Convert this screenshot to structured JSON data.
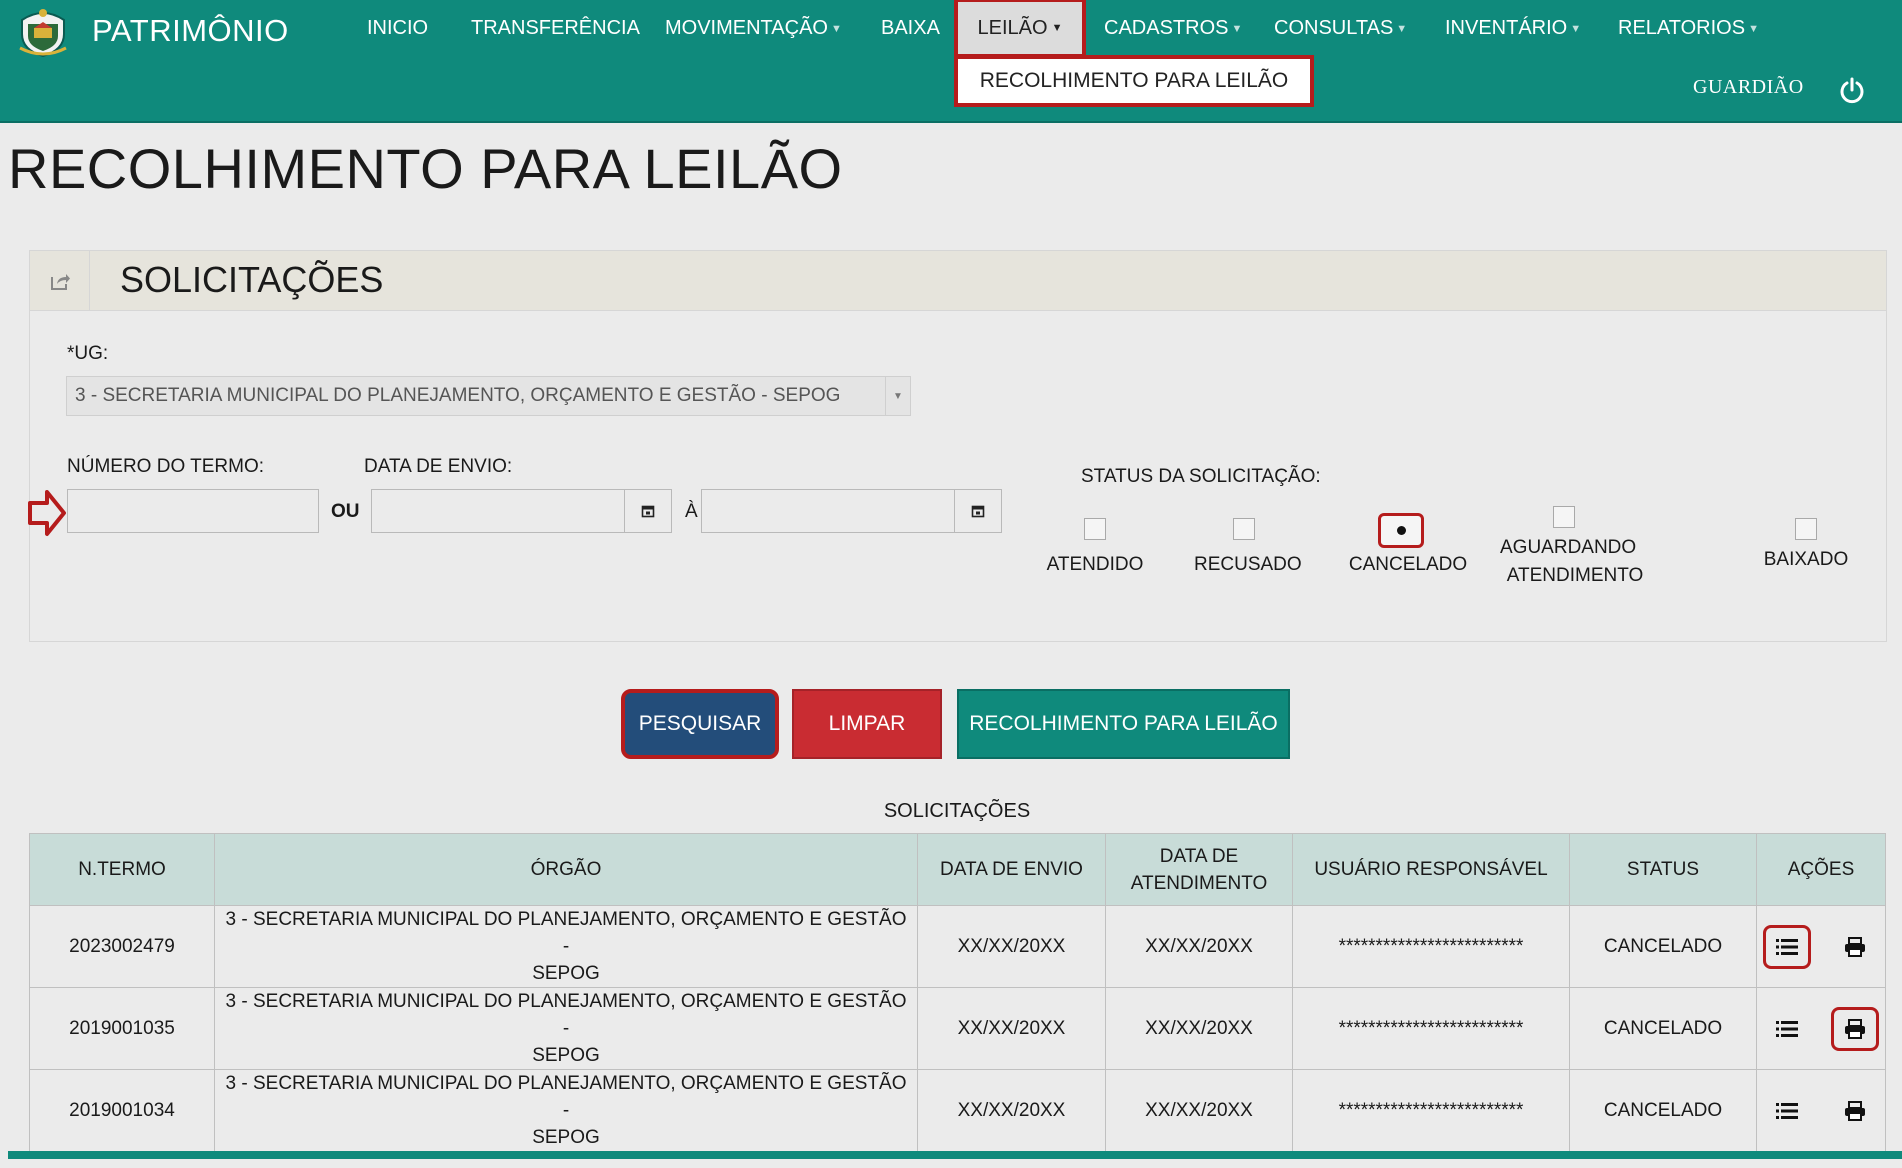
{
  "app": {
    "title": "PATRIMÔNIO"
  },
  "nav": {
    "items": [
      {
        "label": "INICIO",
        "caret": false
      },
      {
        "label": "TRANSFERÊNCIA",
        "caret": false
      },
      {
        "label": "MOVIMENTAÇÃO",
        "caret": true
      },
      {
        "label": "BAIXA",
        "caret": false
      },
      {
        "label": "CADASTROS",
        "caret": true
      },
      {
        "label": "CONSULTAS",
        "caret": true
      },
      {
        "label": "INVENTÁRIO",
        "caret": true
      },
      {
        "label": "RELATORIOS",
        "caret": true
      }
    ],
    "active": {
      "label": "LEILÃO"
    },
    "dropdown_item": "RECOLHIMENTO PARA LEILÃO"
  },
  "user": {
    "name": "GUARDIÃO"
  },
  "page": {
    "title": "RECOLHIMENTO PARA LEILÃO"
  },
  "panel": {
    "title": "SOLICITAÇÕES"
  },
  "form": {
    "ug_label": "*UG:",
    "ug_value": "3 - SECRETARIA MUNICIPAL DO PLANEJAMENTO, ORÇAMENTO E GESTÃO - SEPOG",
    "termo_label": "NÚMERO DO TERMO:",
    "termo_value": "",
    "ou_label": "OU",
    "data_envio_label": "DATA DE ENVIO:",
    "data_inicio_value": "",
    "a_label": "À",
    "data_fim_value": "",
    "status_label": "STATUS DA SOLICITAÇÃO:",
    "status_options": [
      {
        "label": "ATENDIDO",
        "checked": false
      },
      {
        "label": "RECUSADO",
        "checked": false
      },
      {
        "label": "CANCELADO",
        "checked": true
      },
      {
        "label_line1": "AGUARDANDO",
        "label_line2": "ATENDIMENTO",
        "checked": false
      },
      {
        "label": "BAIXADO",
        "checked": false
      }
    ]
  },
  "buttons": {
    "search": "PESQUISAR",
    "clear": "LIMPAR",
    "recolhimento": "RECOLHIMENTO PARA LEILÃO"
  },
  "table": {
    "caption": "SOLICITAÇÕES",
    "headers": {
      "termo": "N.TERMO",
      "orgao": "ÓRGÃO",
      "data_envio": "DATA DE ENVIO",
      "data_atendimento_1": "DATA DE",
      "data_atendimento_2": "ATENDIMENTO",
      "usuario": "USUÁRIO RESPONSÁVEL",
      "status": "STATUS",
      "acoes": "AÇÕES"
    },
    "rows": [
      {
        "termo": "2023002479",
        "orgao_1": "3 - SECRETARIA MUNICIPAL DO PLANEJAMENTO, ORÇAMENTO E GESTÃO -",
        "orgao_2": "SEPOG",
        "data_envio": "XX/XX/20XX",
        "data_atendimento": "XX/XX/20XX",
        "usuario": "*************************",
        "status": "CANCELADO"
      },
      {
        "termo": "2019001035",
        "orgao_1": "3 - SECRETARIA MUNICIPAL DO PLANEJAMENTO, ORÇAMENTO E GESTÃO -",
        "orgao_2": "SEPOG",
        "data_envio": "XX/XX/20XX",
        "data_atendimento": "XX/XX/20XX",
        "usuario": "*************************",
        "status": "CANCELADO"
      },
      {
        "termo": "2019001034",
        "orgao_1": "3 - SECRETARIA MUNICIPAL DO PLANEJAMENTO, ORÇAMENTO E GESTÃO -",
        "orgao_2": "SEPOG",
        "data_envio": "XX/XX/20XX",
        "data_atendimento": "XX/XX/20XX",
        "usuario": "*************************",
        "status": "CANCELADO"
      }
    ],
    "action_icons": [
      "list-icon",
      "print-icon"
    ]
  },
  "colors": {
    "primary": "#0f8a7c",
    "search_button": "#234d7a",
    "clear_button": "#c92c32",
    "highlight": "#b51c1c",
    "table_header": "#c8dcd8"
  }
}
